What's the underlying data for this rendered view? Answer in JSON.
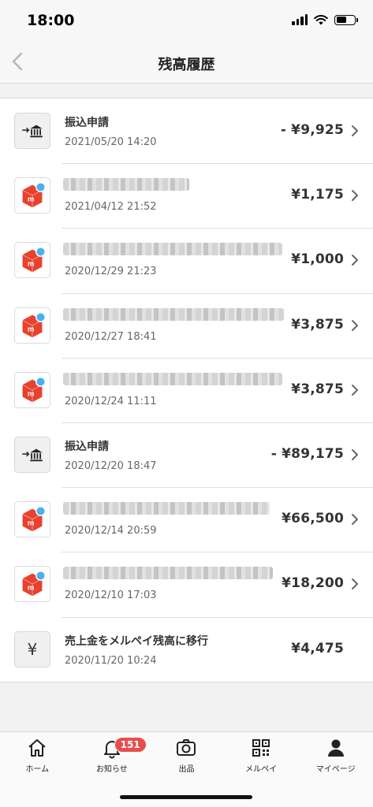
{
  "status": {
    "time": "18:00"
  },
  "nav": {
    "title": "残高履歴"
  },
  "rows": [
    {
      "type": "bank",
      "title": "振込申請",
      "date": "2021/05/20 14:20",
      "amount": "- ¥9,925",
      "chevron": true
    },
    {
      "type": "merc",
      "title": "",
      "date": "2021/04/12 21:52",
      "amount": "¥1,175",
      "chevron": true
    },
    {
      "type": "merc",
      "title": "",
      "date": "2020/12/29 21:23",
      "amount": "¥1,000",
      "chevron": true
    },
    {
      "type": "merc",
      "title": "",
      "date": "2020/12/27 18:41",
      "amount": "¥3,875",
      "chevron": true
    },
    {
      "type": "merc",
      "title": "",
      "date": "2020/12/24 11:11",
      "amount": "¥3,875",
      "chevron": true
    },
    {
      "type": "bank",
      "title": "振込申請",
      "date": "2020/12/20 18:47",
      "amount": "- ¥89,175",
      "chevron": true
    },
    {
      "type": "merc",
      "title": "",
      "date": "2020/12/14 20:59",
      "amount": "¥66,500",
      "chevron": true
    },
    {
      "type": "merc",
      "title": "",
      "date": "2020/12/10 17:03",
      "amount": "¥18,200",
      "chevron": true
    },
    {
      "type": "yen",
      "icon_char": "¥",
      "title": "売上金をメルペイ残高に移行",
      "date": "2020/11/20 10:24",
      "amount": "¥4,475",
      "chevron": false
    }
  ],
  "tabs": [
    {
      "label": "ホーム",
      "icon": "home-icon"
    },
    {
      "label": "お知らせ",
      "icon": "bell-icon",
      "badge": "151"
    },
    {
      "label": "出品",
      "icon": "camera-icon"
    },
    {
      "label": "メルペイ",
      "icon": "qr-code-icon"
    },
    {
      "label": "マイページ",
      "icon": "person-icon"
    }
  ],
  "colors": {
    "brand_red": "#e8412e",
    "badge_red": "#e84d4d",
    "dot_blue": "#4ab0f0"
  }
}
